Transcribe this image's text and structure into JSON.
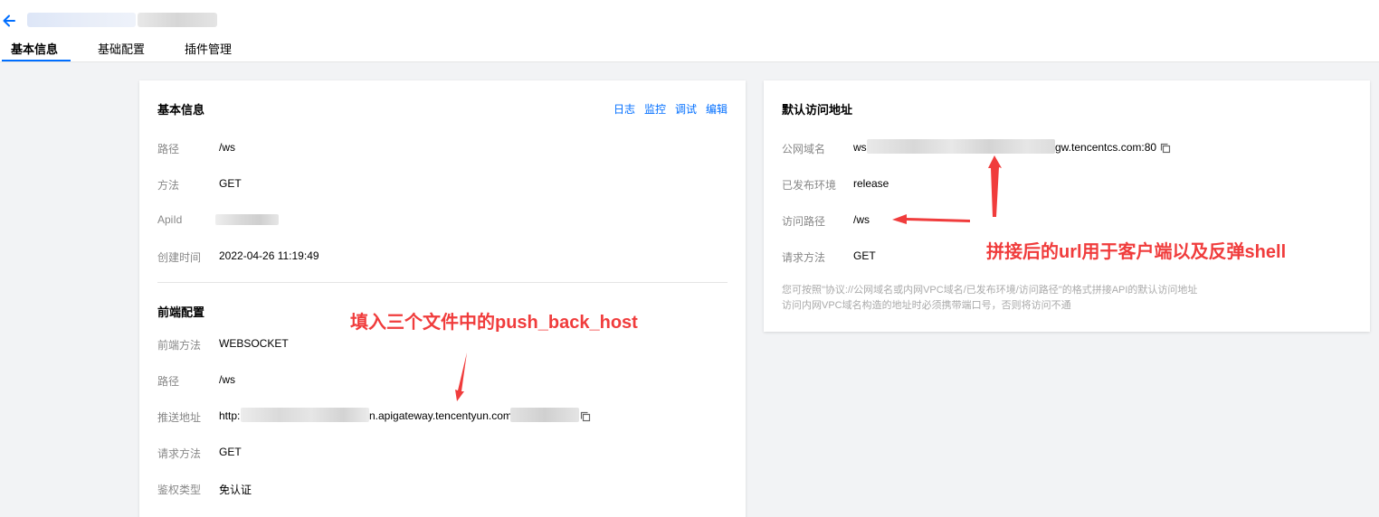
{
  "nav": {
    "tabs": [
      {
        "label": "基本信息",
        "active": true
      },
      {
        "label": "基础配置",
        "active": false
      },
      {
        "label": "插件管理",
        "active": false
      }
    ]
  },
  "basic_info": {
    "title": "基本信息",
    "actions": [
      "日志",
      "监控",
      "调试",
      "编辑"
    ],
    "rows": [
      {
        "label": "路径",
        "value": "/ws"
      },
      {
        "label": "方法",
        "value": "GET"
      },
      {
        "label": "ApiId",
        "value": ""
      },
      {
        "label": "创建时间",
        "value": "2022-04-26 11:19:49"
      }
    ]
  },
  "frontend_config": {
    "title": "前端配置",
    "rows": [
      {
        "label": "前端方法",
        "value": "WEBSOCKET"
      },
      {
        "label": "路径",
        "value": "/ws"
      },
      {
        "label": "推送地址",
        "value_prefix": "http:",
        "value_mid": "n.apigateway.tencentyun.com"
      },
      {
        "label": "请求方法",
        "value": "GET"
      },
      {
        "label": "鉴权类型",
        "value": "免认证"
      }
    ]
  },
  "default_access": {
    "title": "默认访问地址",
    "rows": [
      {
        "label": "公网域名",
        "value_prefix": "ws",
        "value_suffix": "gw.tencentcs.com:80"
      },
      {
        "label": "已发布环境",
        "value": "release"
      },
      {
        "label": "访问路径",
        "value": "/ws"
      },
      {
        "label": "请求方法",
        "value": "GET"
      }
    ],
    "hint_lines": [
      "您可按照\"协议://公网域名或内网VPC域名/已发布环境/访问路径\"的格式拼接API的默认访问地址",
      "访问内网VPC域名构造的地址时必须携带端口号，否则将访问不通"
    ]
  },
  "annotations": {
    "push_back_host": "填入三个文件中的push_back_host",
    "url_note": "拼接后的url用于客户端以及反弹shell"
  },
  "colors": {
    "accent": "#006eff",
    "annotation": "#f03c3c"
  }
}
